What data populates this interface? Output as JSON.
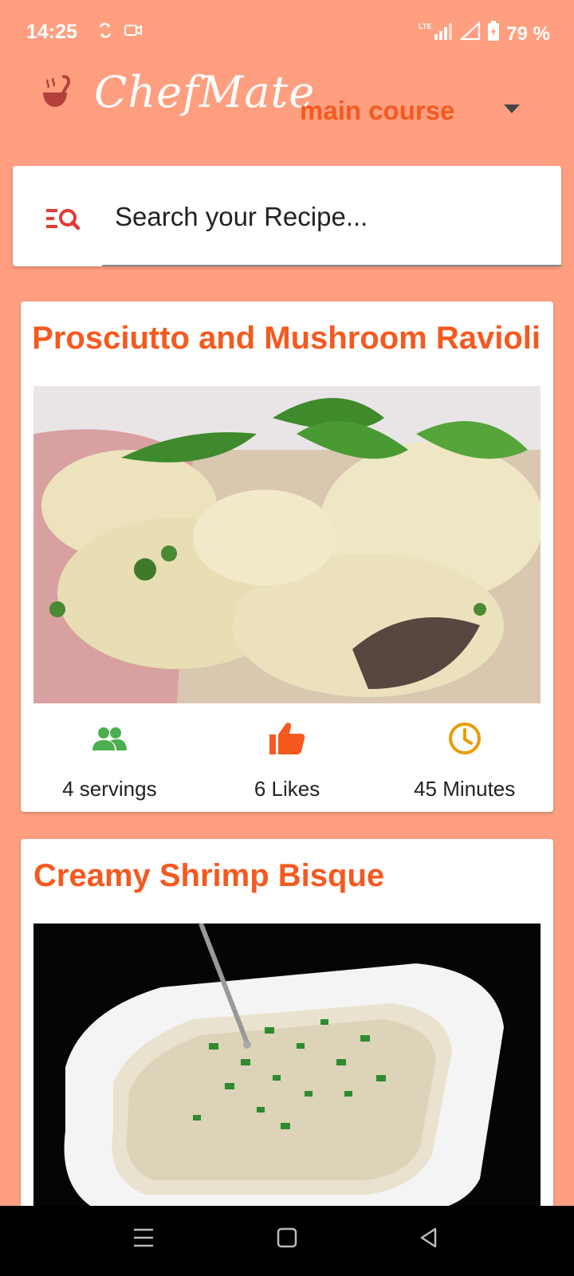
{
  "status_bar": {
    "time": "14:25",
    "network": "LTE",
    "battery": "79 %"
  },
  "header": {
    "brand": "ChefMate",
    "category": "main course"
  },
  "search": {
    "placeholder": "Search your Recipe..."
  },
  "recipes": [
    {
      "title": "Prosciutto and Mushroom Ravioli",
      "servings": "4 servings",
      "likes": "6 Likes",
      "time": "45 Minutes"
    },
    {
      "title": "Creamy Shrimp Bisque"
    }
  ],
  "colors": {
    "background": "#FF9F80",
    "accent": "#F5591F",
    "servings_icon": "#4CAF50",
    "likes_icon": "#F5591F",
    "time_icon": "#E89C00"
  },
  "icons": {
    "logo": "ladle-icon",
    "search": "list-search-icon",
    "servings": "people-icon",
    "likes": "thumb-up-icon",
    "time": "clock-icon"
  }
}
